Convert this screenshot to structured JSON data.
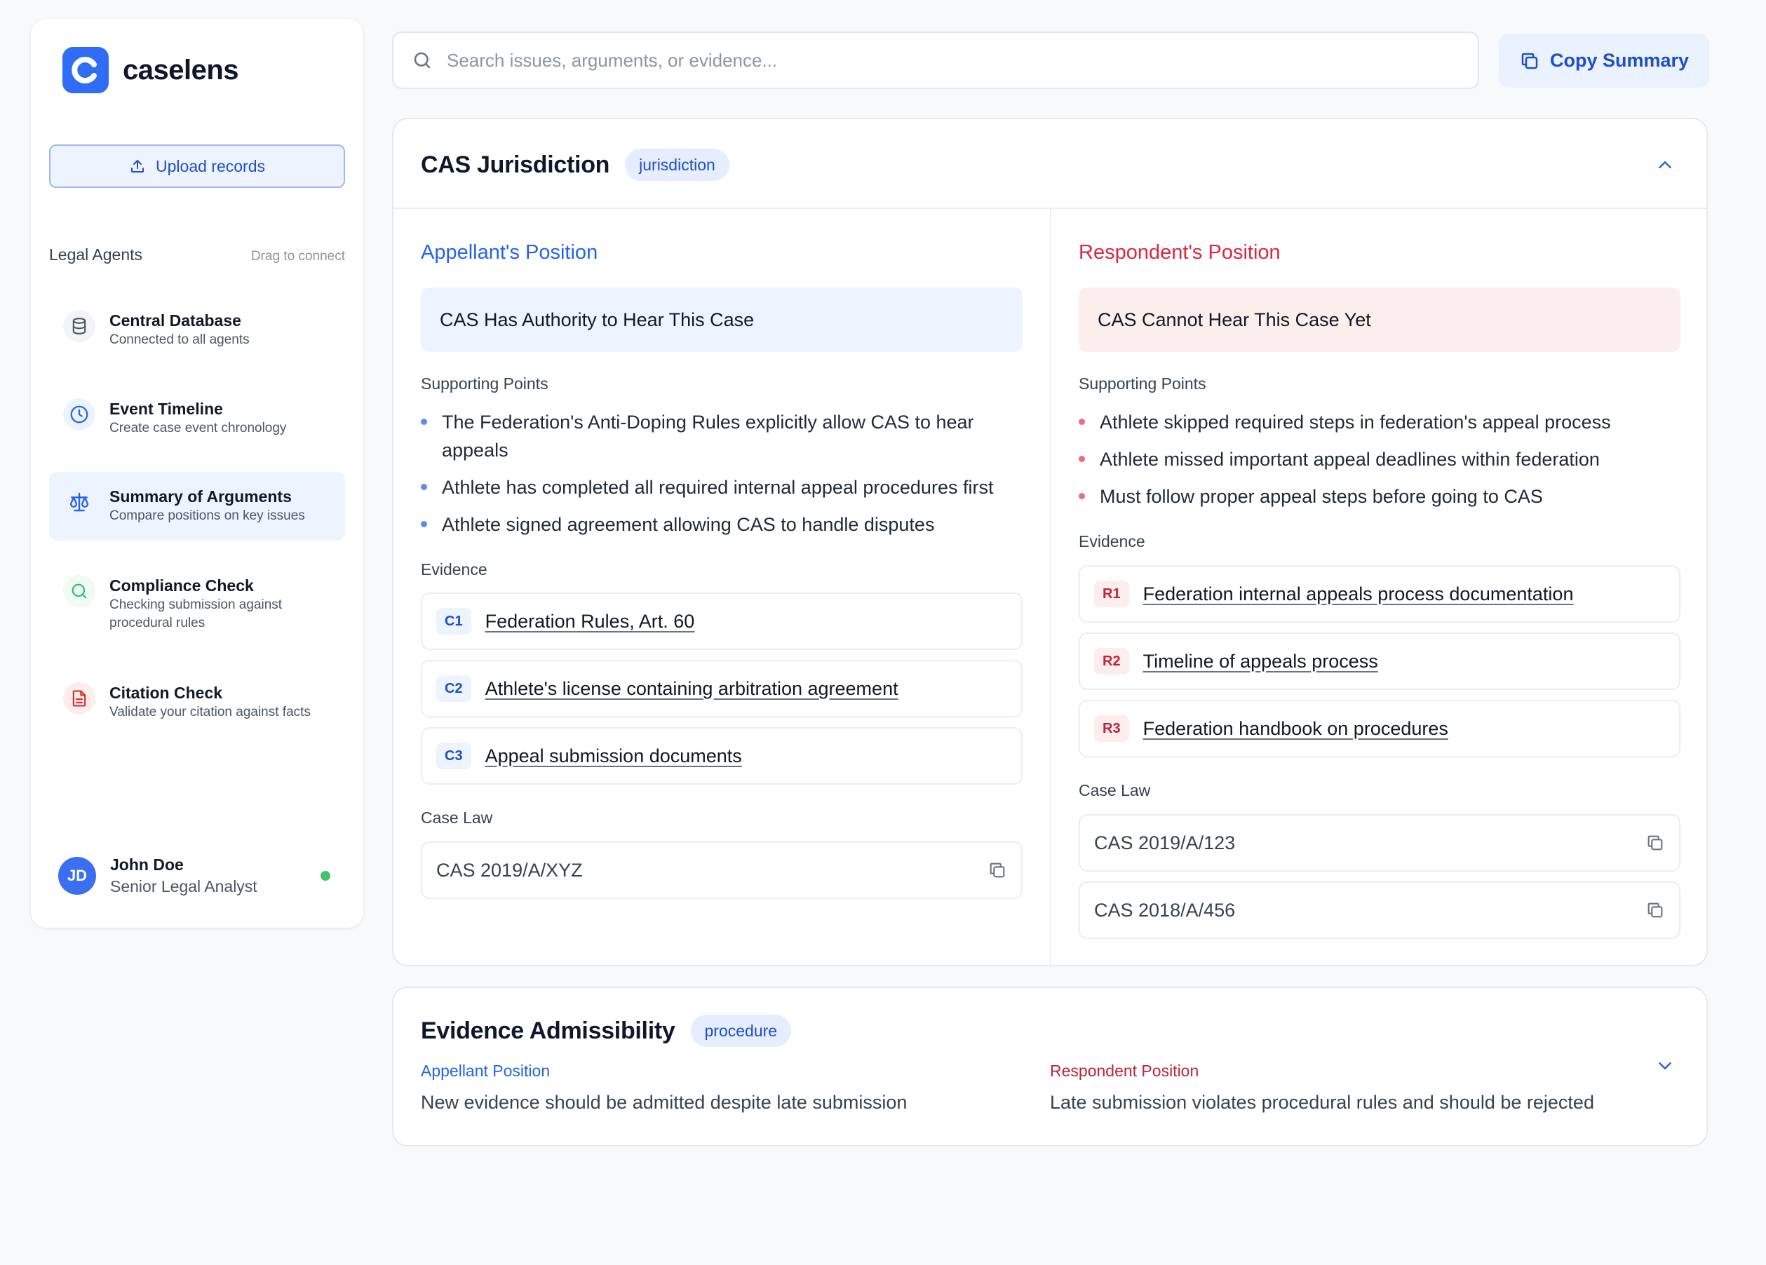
{
  "brand": {
    "name": "caselens"
  },
  "sidebar": {
    "upload_label": "Upload records",
    "agents_title": "Legal Agents",
    "agents_hint": "Drag to connect",
    "agents": [
      {
        "name": "Central Database",
        "desc": "Connected to all agents",
        "icon": "database-icon",
        "color": "#4b5563"
      },
      {
        "name": "Event Timeline",
        "desc": "Create case event chronology",
        "icon": "clock-icon",
        "color": "#2563eb"
      },
      {
        "name": "Summary of Arguments",
        "desc": "Compare positions on key issues",
        "icon": "scale-icon",
        "color": "#2563eb"
      },
      {
        "name": "Compliance Check",
        "desc": "Checking submission against procedural rules",
        "icon": "search-check-icon",
        "color": "#22c55e"
      },
      {
        "name": "Citation Check",
        "desc": "Validate your citation against facts",
        "icon": "document-icon",
        "color": "#dc2626"
      }
    ],
    "user": {
      "initials": "JD",
      "name": "John Doe",
      "role": "Senior Legal Analyst"
    }
  },
  "search": {
    "placeholder": "Search issues, arguments, or evidence..."
  },
  "toolbar": {
    "copy_summary_label": "Copy Summary"
  },
  "issues": [
    {
      "title": "CAS Jurisdiction",
      "tag": "jurisdiction",
      "appellant": {
        "heading": "Appellant's Position",
        "claim": "CAS Has Authority to Hear This Case",
        "supporting_label": "Supporting Points",
        "points": [
          "The Federation's Anti-Doping Rules explicitly allow CAS to hear appeals",
          "Athlete has completed all required internal appeal procedures first",
          "Athlete signed agreement allowing CAS to handle disputes"
        ],
        "evidence_label": "Evidence",
        "evidence": [
          {
            "id": "C1",
            "text": "Federation Rules, Art. 60"
          },
          {
            "id": "C2",
            "text": "Athlete's license containing arbitration agreement"
          },
          {
            "id": "C3",
            "text": "Appeal submission documents"
          }
        ],
        "caselaw_label": "Case Law",
        "caselaw": [
          "CAS 2019/A/XYZ"
        ]
      },
      "respondent": {
        "heading": "Respondent's Position",
        "claim": "CAS Cannot Hear This Case Yet",
        "supporting_label": "Supporting Points",
        "points": [
          "Athlete skipped required steps in federation's appeal process",
          "Athlete missed important appeal deadlines within federation",
          "Must follow proper appeal steps before going to CAS"
        ],
        "evidence_label": "Evidence",
        "evidence": [
          {
            "id": "R1",
            "text": "Federation internal appeals process documentation"
          },
          {
            "id": "R2",
            "text": "Timeline of appeals process"
          },
          {
            "id": "R3",
            "text": "Federation handbook on procedures"
          }
        ],
        "caselaw_label": "Case Law",
        "caselaw": [
          "CAS 2019/A/123",
          "CAS 2018/A/456"
        ]
      }
    },
    {
      "title": "Evidence Admissibility",
      "tag": "procedure",
      "appellant_label": "Appellant Position",
      "appellant_text": "New evidence should be admitted despite late submission",
      "respondent_label": "Respondent Position",
      "respondent_text": "Late submission violates procedural rules and should be rejected"
    }
  ],
  "colors": {
    "accent": "#2f6df6",
    "appellant": "#2563eb",
    "respondent": "#dc2642",
    "online": "#45c16b"
  }
}
